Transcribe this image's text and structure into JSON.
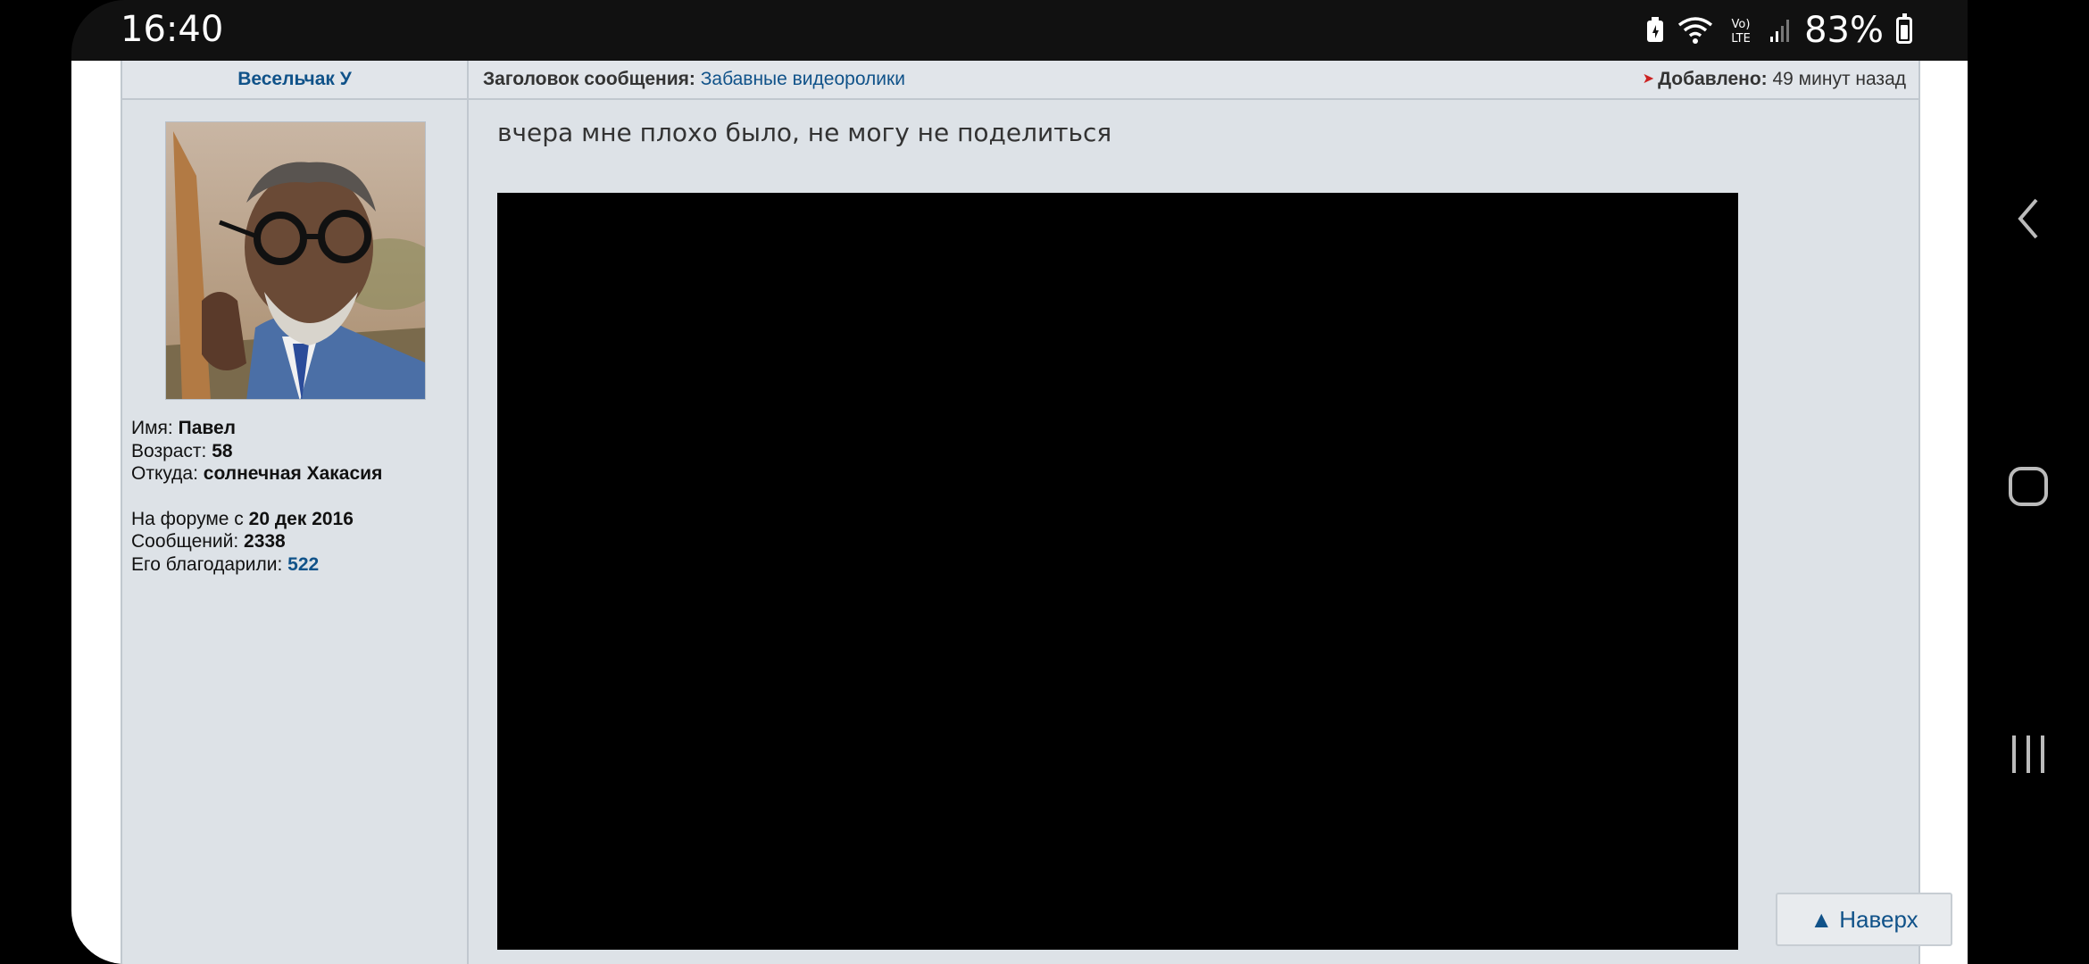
{
  "status_bar": {
    "time": "16:40",
    "battery_percent": "83%"
  },
  "post": {
    "author": "Весельчак У",
    "subject_label": "Заголовок сообщения:",
    "subject": "Забавные видеоролики",
    "added_label": "Добавлено:",
    "added_value": "49 минут назад",
    "message": "вчера мне плохо было, не могу не поделиться"
  },
  "profile": {
    "name_label": "Имя:",
    "name": "Павел",
    "age_label": "Возраст:",
    "age": "58",
    "from_label": "Откуда:",
    "from": "солнечная Хакасия",
    "since_label": "На форуме с",
    "since": "20 дек 2016",
    "posts_label": "Сообщений:",
    "posts": "2338",
    "thanks_label": "Его благодарили:",
    "thanks": "522"
  },
  "back_to_top": "▲ Наверх",
  "colors": {
    "link": "#105289",
    "table_bg": "#dde2e7",
    "border": "#c1c8cf"
  }
}
